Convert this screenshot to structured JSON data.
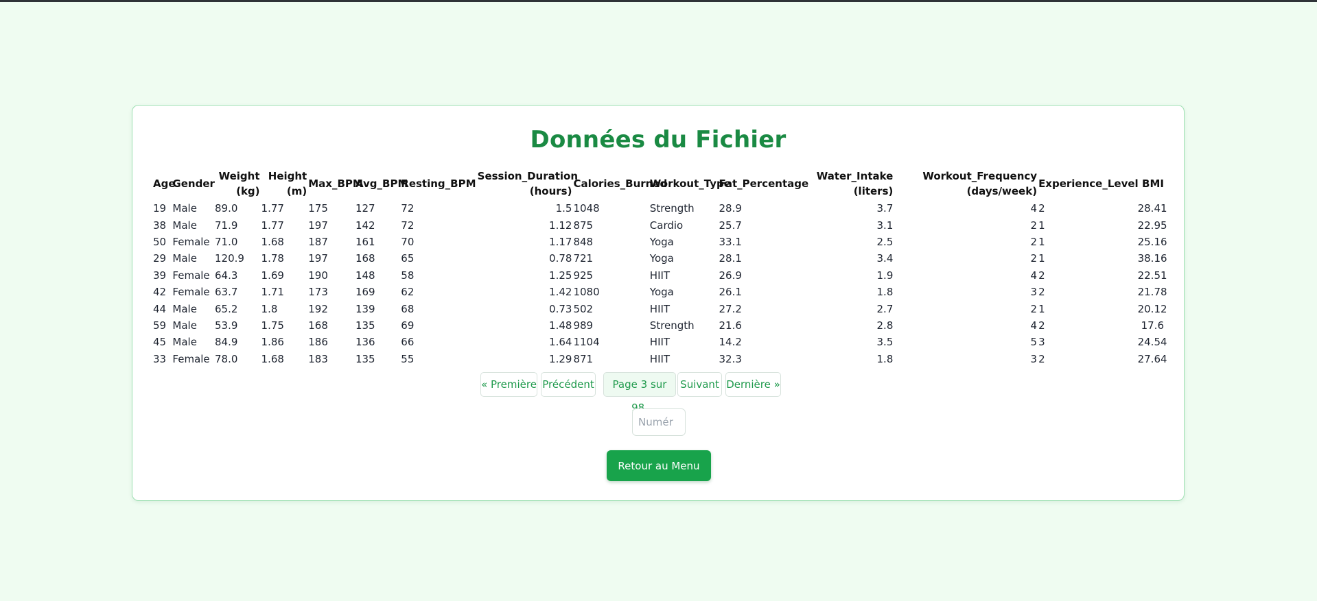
{
  "page": {
    "title": "Données du Fichier",
    "back_label": "Retour au Menu",
    "goto_placeholder": "Numér"
  },
  "table": {
    "headers": [
      "Age",
      "Gender",
      "Weight (kg)",
      "Height (m)",
      "Max_BPM",
      "Avg_BPM",
      "Resting_BPM",
      "Session_Duration (hours)",
      "Calories_Burned",
      "Workout_Type",
      "Fat_Percentage",
      "Water_Intake (liters)",
      "Workout_Frequency (days/week)",
      "Experience_Level",
      "BMI"
    ],
    "rows": [
      [
        "19",
        "Male",
        "89.0",
        "1.77",
        "175",
        "127",
        "72",
        "1.5",
        "1048",
        "Strength",
        "28.9",
        "3.7",
        "4",
        "2",
        "28.41"
      ],
      [
        "38",
        "Male",
        "71.9",
        "1.77",
        "197",
        "142",
        "72",
        "1.12",
        "875",
        "Cardio",
        "25.7",
        "3.1",
        "2",
        "1",
        "22.95"
      ],
      [
        "50",
        "Female",
        "71.0",
        "1.68",
        "187",
        "161",
        "70",
        "1.17",
        "848",
        "Yoga",
        "33.1",
        "2.5",
        "2",
        "1",
        "25.16"
      ],
      [
        "29",
        "Male",
        "120.9",
        "1.78",
        "197",
        "168",
        "65",
        "0.78",
        "721",
        "Yoga",
        "28.1",
        "3.4",
        "2",
        "1",
        "38.16"
      ],
      [
        "39",
        "Female",
        "64.3",
        "1.69",
        "190",
        "148",
        "58",
        "1.25",
        "925",
        "HIIT",
        "26.9",
        "1.9",
        "4",
        "2",
        "22.51"
      ],
      [
        "42",
        "Female",
        "63.7",
        "1.71",
        "173",
        "169",
        "62",
        "1.42",
        "1080",
        "Yoga",
        "26.1",
        "1.8",
        "3",
        "2",
        "21.78"
      ],
      [
        "44",
        "Male",
        "65.2",
        "1.8",
        "192",
        "139",
        "68",
        "0.73",
        "502",
        "HIIT",
        "27.2",
        "2.7",
        "2",
        "1",
        "20.12"
      ],
      [
        "59",
        "Male",
        "53.9",
        "1.75",
        "168",
        "135",
        "69",
        "1.48",
        "989",
        "Strength",
        "21.6",
        "2.8",
        "4",
        "2",
        "17.6"
      ],
      [
        "45",
        "Male",
        "84.9",
        "1.86",
        "186",
        "136",
        "66",
        "1.64",
        "1104",
        "HIIT",
        "14.2",
        "3.5",
        "5",
        "3",
        "24.54"
      ],
      [
        "33",
        "Female",
        "78.0",
        "1.68",
        "183",
        "135",
        "55",
        "1.29",
        "871",
        "HIIT",
        "32.3",
        "1.8",
        "3",
        "2",
        "27.64"
      ]
    ]
  },
  "pagination": {
    "first": "« Première",
    "prev": "Précédent",
    "status": "Page 3 sur 98.",
    "next": "Suivant",
    "last": "Dernière »"
  },
  "colors": {
    "background": "#effcf1",
    "title": "#1a8a43",
    "accent": "#18a34b",
    "card_border": "#9fe0b3"
  }
}
